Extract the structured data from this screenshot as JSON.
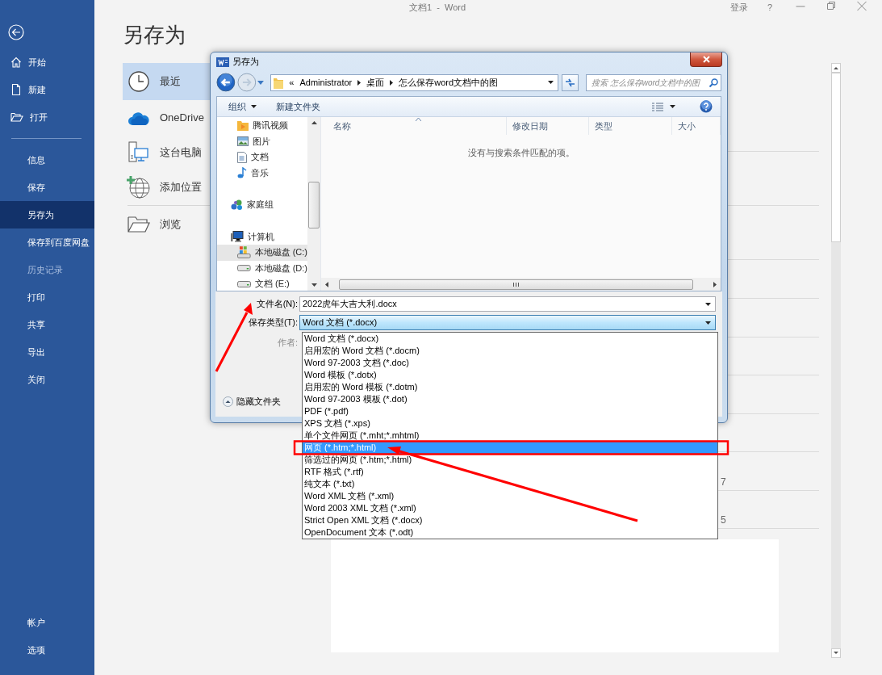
{
  "app_window": {
    "title": "文档1  -  Word",
    "sign_in": "登录",
    "help": "?"
  },
  "sidebar": {
    "top_items": [
      {
        "label": "开始",
        "selected": false,
        "disabled": false
      },
      {
        "label": "新建",
        "selected": false,
        "disabled": false
      },
      {
        "label": "打开",
        "selected": false,
        "disabled": false
      }
    ],
    "items": [
      {
        "label": "信息",
        "selected": false,
        "disabled": false
      },
      {
        "label": "保存",
        "selected": false,
        "disabled": false
      },
      {
        "label": "另存为",
        "selected": true,
        "disabled": false
      },
      {
        "label": "保存到百度网盘",
        "selected": false,
        "disabled": false
      },
      {
        "label": "历史记录",
        "selected": false,
        "disabled": true
      },
      {
        "label": "打印",
        "selected": false,
        "disabled": false
      },
      {
        "label": "共享",
        "selected": false,
        "disabled": false
      },
      {
        "label": "导出",
        "selected": false,
        "disabled": false
      },
      {
        "label": "关闭",
        "selected": false,
        "disabled": false
      }
    ],
    "bottom_items": [
      {
        "label": "帐户",
        "selected": false,
        "disabled": false
      },
      {
        "label": "选项",
        "selected": false,
        "disabled": false
      }
    ]
  },
  "backstage": {
    "heading": "另存为",
    "places": [
      {
        "label": "最近",
        "kind": "location",
        "selected": true
      },
      {
        "label": "OneDrive",
        "kind": "location",
        "selected": false
      },
      {
        "label": "这台电脑",
        "kind": "location",
        "selected": false
      },
      {
        "label": "添加位置",
        "kind": "location",
        "selected": false
      },
      {
        "label": "浏览",
        "kind": "browse",
        "selected": false
      }
    ],
    "list_fragments": [
      "7",
      "5"
    ]
  },
  "dialog": {
    "title": "另存为",
    "breadcrumb_overflow": "«",
    "breadcrumb": [
      "Administrator",
      "桌面",
      "怎么保存word文档中的图"
    ],
    "search_placeholder": "搜索 怎么保存word文档中的图",
    "toolbar": [
      {
        "label": "组织",
        "menu": true
      },
      {
        "label": "新建文件夹",
        "menu": false
      }
    ],
    "nav": [
      {
        "children": [
          {
            "label": "腾讯视频",
            "kind": "folder",
            "selected": false
          },
          {
            "label": "图片",
            "kind": "pictures",
            "selected": false
          },
          {
            "label": "文档",
            "kind": "documents",
            "selected": false
          },
          {
            "label": "音乐",
            "kind": "music",
            "selected": false
          }
        ]
      },
      {
        "label": "家庭组",
        "kind": "homegroup",
        "selected": false
      },
      {
        "label": "计算机",
        "kind": "computer",
        "selected": false,
        "children": [
          {
            "label": "本地磁盘 (C:)",
            "kind": "system-drive",
            "selected": true
          },
          {
            "label": "本地磁盘 (D:)",
            "kind": "drive",
            "selected": false
          },
          {
            "label": "文档 (E:)",
            "kind": "drive",
            "selected": false
          }
        ]
      }
    ],
    "columns": [
      "名称",
      "修改日期",
      "类型",
      "大小"
    ],
    "empty_message": "没有与搜索条件匹配的项。",
    "filename_label": "文件名(N):",
    "filename": "2022虎年大吉大利.docx",
    "type_label": "保存类型(T):",
    "type": "Word 文档 (*.docx)",
    "author_label": "作者:",
    "hide_folders": "隐藏文件夹"
  },
  "type_dropdown": {
    "options": [
      {
        "label": "Word 文档 (*.docx)",
        "selected": false
      },
      {
        "label": "启用宏的 Word 文档 (*.docm)",
        "selected": false
      },
      {
        "label": "Word 97-2003 文档 (*.doc)",
        "selected": false
      },
      {
        "label": "Word 模板 (*.dotx)",
        "selected": false
      },
      {
        "label": "启用宏的 Word 模板 (*.dotm)",
        "selected": false
      },
      {
        "label": "Word 97-2003 模板 (*.dot)",
        "selected": false
      },
      {
        "label": "PDF (*.pdf)",
        "selected": false
      },
      {
        "label": "XPS 文档 (*.xps)",
        "selected": false
      },
      {
        "label": "单个文件网页 (*.mht;*.mhtml)",
        "selected": false
      },
      {
        "label": "网页 (*.htm;*.html)",
        "selected": true
      },
      {
        "label": "筛选过的网页 (*.htm;*.html)",
        "selected": false
      },
      {
        "label": "RTF 格式 (*.rtf)",
        "selected": false
      },
      {
        "label": "纯文本 (*.txt)",
        "selected": false
      },
      {
        "label": "Word XML 文档 (*.xml)",
        "selected": false
      },
      {
        "label": "Word 2003 XML 文档 (*.xml)",
        "selected": false
      },
      {
        "label": "Strict Open XML 文档 (*.docx)",
        "selected": false
      },
      {
        "label": "OpenDocument 文本 (*.odt)",
        "selected": false
      }
    ]
  }
}
